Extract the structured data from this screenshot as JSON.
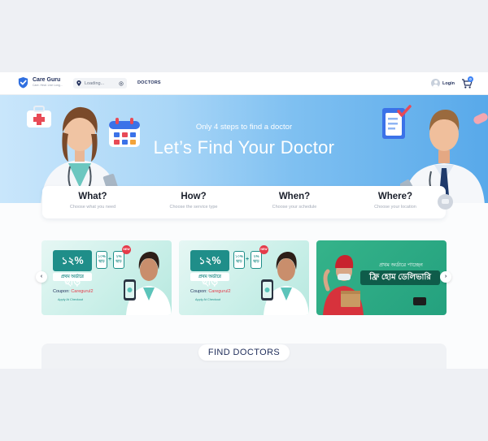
{
  "header": {
    "brand_name": "Care Guru",
    "brand_tagline": "Care. Heal. Live Long...",
    "location_text": "Loading...",
    "nav_doctors": "DOCTORS",
    "login_label": "Login",
    "cart_count": "0"
  },
  "hero": {
    "subtitle": "Only 4 steps to find a doctor",
    "title": "Let’s Find Your Doctor"
  },
  "steps": [
    {
      "title": "What?",
      "desc": "Choose what you need"
    },
    {
      "title": "How?",
      "desc": "Choose the service type"
    },
    {
      "title": "When?",
      "desc": "Choose your schedule"
    },
    {
      "title": "Where?",
      "desc": "Choose your location"
    }
  ],
  "banners": {
    "promo": {
      "discount": "১২% ছাড়",
      "first_order": "প্রথম অর্ডারে",
      "chip1": "১০% ছাড়",
      "chip2": "২% ছাড়",
      "new_tag": "NEW",
      "coupon_label": "Coupon:",
      "coupon_code": "Caregurul2",
      "apply_text": "Apply At Checkout"
    },
    "delivery": {
      "line1": "প্রথম অর্ডারে পাচ্ছেন",
      "line2": "ফ্রি হোম ডেলিভারি"
    }
  },
  "carousel": {
    "prev_arrow": "‹",
    "next_arrow": "›"
  },
  "find_doctors": {
    "label": "FIND DOCTORS"
  },
  "colors": {
    "brand_navy": "#1f2d5a",
    "hero_blue": "#58a9ea",
    "promo_teal": "#1f8e89",
    "delivery_green": "#24a17e",
    "accent_red": "#e53b4a"
  }
}
